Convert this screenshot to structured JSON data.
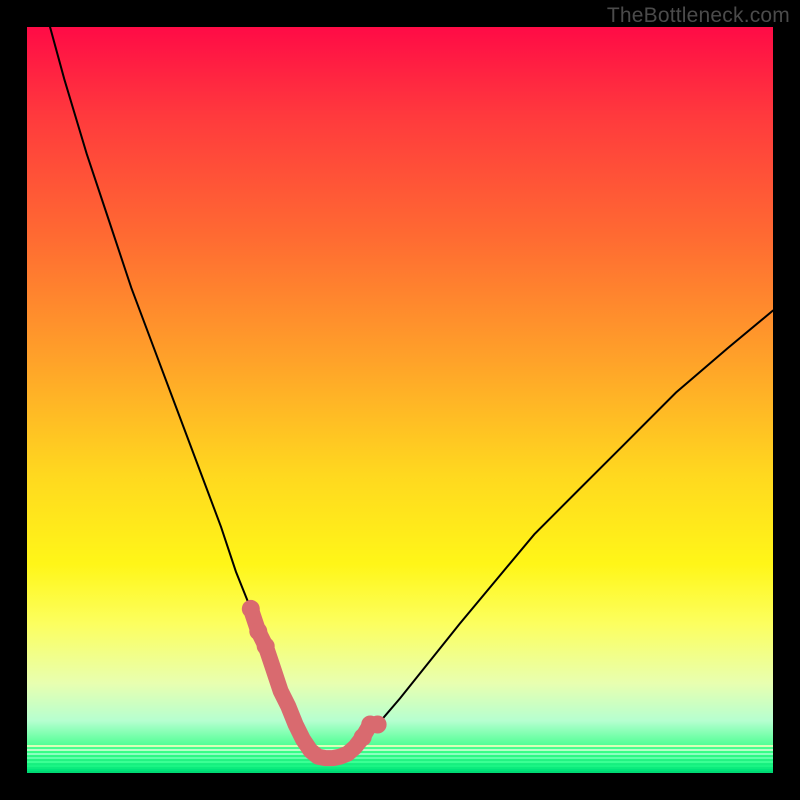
{
  "attribution": "TheBottleneck.com",
  "colors": {
    "frame_bg": "#000000",
    "curve_stroke": "#000000",
    "marker_fill": "#d96a6f",
    "gradient_top": "#ff0b46",
    "gradient_bottom": "#00e57a"
  },
  "chart_data": {
    "type": "line",
    "title": "",
    "xlabel": "",
    "ylabel": "",
    "xlim": [
      0,
      100
    ],
    "ylim": [
      0,
      100
    ],
    "grid": false,
    "legend": false,
    "annotations": [],
    "series": [
      {
        "name": "bottleneck-curve",
        "x": [
          0,
          2,
          5,
          8,
          11,
          14,
          17,
          20,
          23,
          26,
          28,
          30,
          32,
          33.5,
          35,
          36,
          37,
          38,
          39,
          40,
          42,
          44,
          47,
          50,
          54,
          58,
          63,
          68,
          74,
          80,
          87,
          94,
          100
        ],
        "y": [
          112,
          104,
          93,
          83,
          74,
          65,
          57,
          49,
          41,
          33,
          27,
          22,
          17,
          13,
          9,
          6.5,
          4.5,
          3,
          2.2,
          2,
          2.2,
          3.5,
          6.5,
          10,
          15,
          20,
          26,
          32,
          38,
          44,
          51,
          57,
          62
        ]
      },
      {
        "name": "highlight-markers",
        "x": [
          30,
          31,
          32,
          33,
          34,
          35,
          36,
          37,
          38,
          39,
          40,
          41,
          42,
          43,
          44,
          45,
          46,
          47
        ],
        "y": [
          22,
          19,
          17,
          14,
          11,
          9,
          6.5,
          4.5,
          3,
          2.2,
          2,
          2,
          2.2,
          2.6,
          3.5,
          4.8,
          6.5,
          6.5
        ]
      }
    ]
  }
}
